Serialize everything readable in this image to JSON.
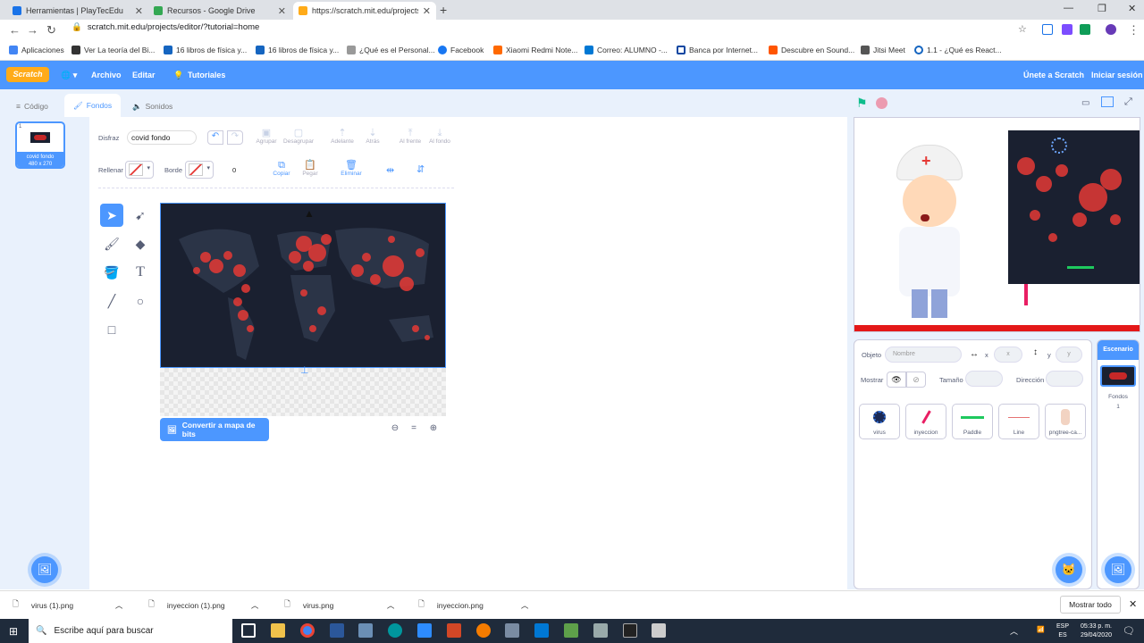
{
  "browser": {
    "tabs": [
      {
        "title": "Herramientas | PlayTecEdu"
      },
      {
        "title": "Recursos - Google Drive"
      },
      {
        "title": "https://scratch.mit.edu/projects/e"
      }
    ],
    "url": "scratch.mit.edu/projects/editor/?tutorial=home",
    "bookmarks": [
      "Aplicaciones",
      "Ver La teoría del Bi...",
      "16 libros de física y...",
      "16 libros de física y...",
      "¿Qué es el Personal...",
      "Facebook",
      "Xiaomi Redmi Note...",
      "Correo: ALUMNO -...",
      "Banca por Internet...",
      "Descubre en Sound...",
      "Jitsi Meet",
      "1.1 - ¿Qué es React..."
    ]
  },
  "scratch_menu": {
    "logo": "Scratch",
    "archivo": "Archivo",
    "editar": "Editar",
    "tutoriales": "Tutoriales",
    "unete": "Únete a Scratch",
    "iniciar": "Iniciar sesión"
  },
  "editor_tabs": {
    "codigo": "Código",
    "fondos": "Fondos",
    "sonidos": "Sonidos"
  },
  "costume": {
    "index": "1",
    "name": "covid fondo",
    "size": "480 x 270"
  },
  "paint": {
    "disfraz_label": "Disfraz",
    "costume_name": "covid fondo",
    "agrupar": "Agrupar",
    "desagrupar": "Desagrupar",
    "adelante": "Adelante",
    "atras": "Atrás",
    "al_frente": "Al frente",
    "al_fondo": "Al fondo",
    "rellenar": "Rellenar",
    "borde": "Borde",
    "border_width": "0",
    "copiar": "Copiar",
    "pegar": "Pegar",
    "eliminar": "Eliminar",
    "convert": "Convertir a mapa de bits"
  },
  "sprite_info": {
    "objeto": "Objeto",
    "nombre_placeholder": "Nombre",
    "x_label": "x",
    "y_label": "y",
    "x_placeholder": "x",
    "y_placeholder": "y",
    "mostrar": "Mostrar",
    "tamano": "Tamaño",
    "direccion": "Dirección"
  },
  "sprites": [
    {
      "name": "virus"
    },
    {
      "name": "inyeccion"
    },
    {
      "name": "Paddle"
    },
    {
      "name": "Line"
    },
    {
      "name": "pngtree-ca..."
    }
  ],
  "stage_panel": {
    "title": "Escenario",
    "fondos_label": "Fondos",
    "fondos_count": "1"
  },
  "downloads": {
    "items": [
      "virus (1).png",
      "inyeccion (1).png",
      "virus.png",
      "inyeccion.png"
    ],
    "show_all": "Mostrar todo"
  },
  "taskbar": {
    "search": "Escribe aquí para buscar",
    "lang1": "ESP",
    "lang2": "ES",
    "time": "05:33 p. m.",
    "date": "29/04/2020"
  },
  "colors": {
    "scratch_blue": "#4c97ff",
    "orange": "#ffab19",
    "taskbar": "#1f2b3b"
  }
}
